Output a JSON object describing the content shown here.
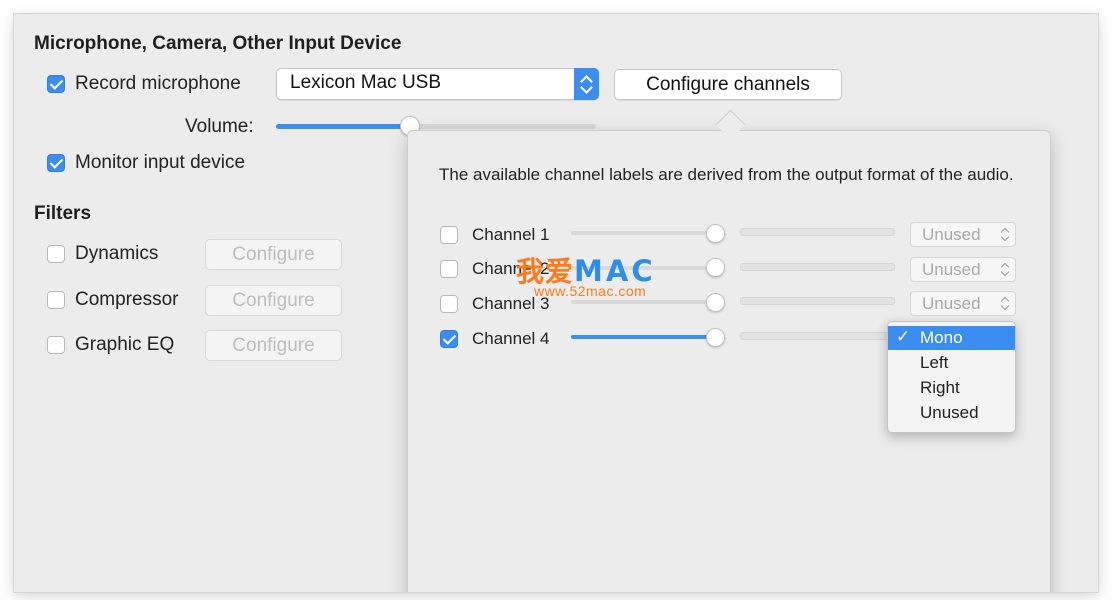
{
  "input_section": {
    "heading": "Microphone, Camera, Other Input Device",
    "record_microphone": {
      "label": "Record microphone",
      "checked": true
    },
    "device_popup": {
      "value": "Lexicon Mac USB"
    },
    "configure_channels_label": "Configure channels",
    "volume": {
      "label": "Volume:",
      "level": 0.52
    },
    "monitor_input": {
      "label": "Monitor input device",
      "checked": true
    }
  },
  "filters": {
    "heading": "Filters",
    "items": [
      {
        "label": "Dynamics",
        "checked": false,
        "button": "Configure"
      },
      {
        "label": "Compressor",
        "checked": false,
        "button": "Configure"
      },
      {
        "label": "Graphic EQ",
        "checked": false,
        "button": "Configure"
      }
    ]
  },
  "channels_panel": {
    "description": "The available channel labels are derived from the output format of the audio.",
    "channels": [
      {
        "label": "Channel 1",
        "checked": false,
        "level": 1.0,
        "mapping": "Unused"
      },
      {
        "label": "Channel 2",
        "checked": false,
        "level": 1.0,
        "mapping": "Unused"
      },
      {
        "label": "Channel 3",
        "checked": false,
        "level": 1.0,
        "mapping": "Unused"
      },
      {
        "label": "Channel 4",
        "checked": true,
        "level": 1.0,
        "mapping": "Mono"
      }
    ],
    "mapping_menu": {
      "check_mark": "✓",
      "options": [
        "Mono",
        "Left",
        "Right",
        "Unused"
      ],
      "selected": "Mono"
    }
  },
  "watermark": {
    "cn": "我爱",
    "en": "MAC",
    "url": "www.52mac.com"
  },
  "colors": {
    "accent": "#3b8df0",
    "window_bg": "#ececec",
    "watermark_orange": "#ff7a1a",
    "watermark_blue": "#2f8ee8"
  }
}
